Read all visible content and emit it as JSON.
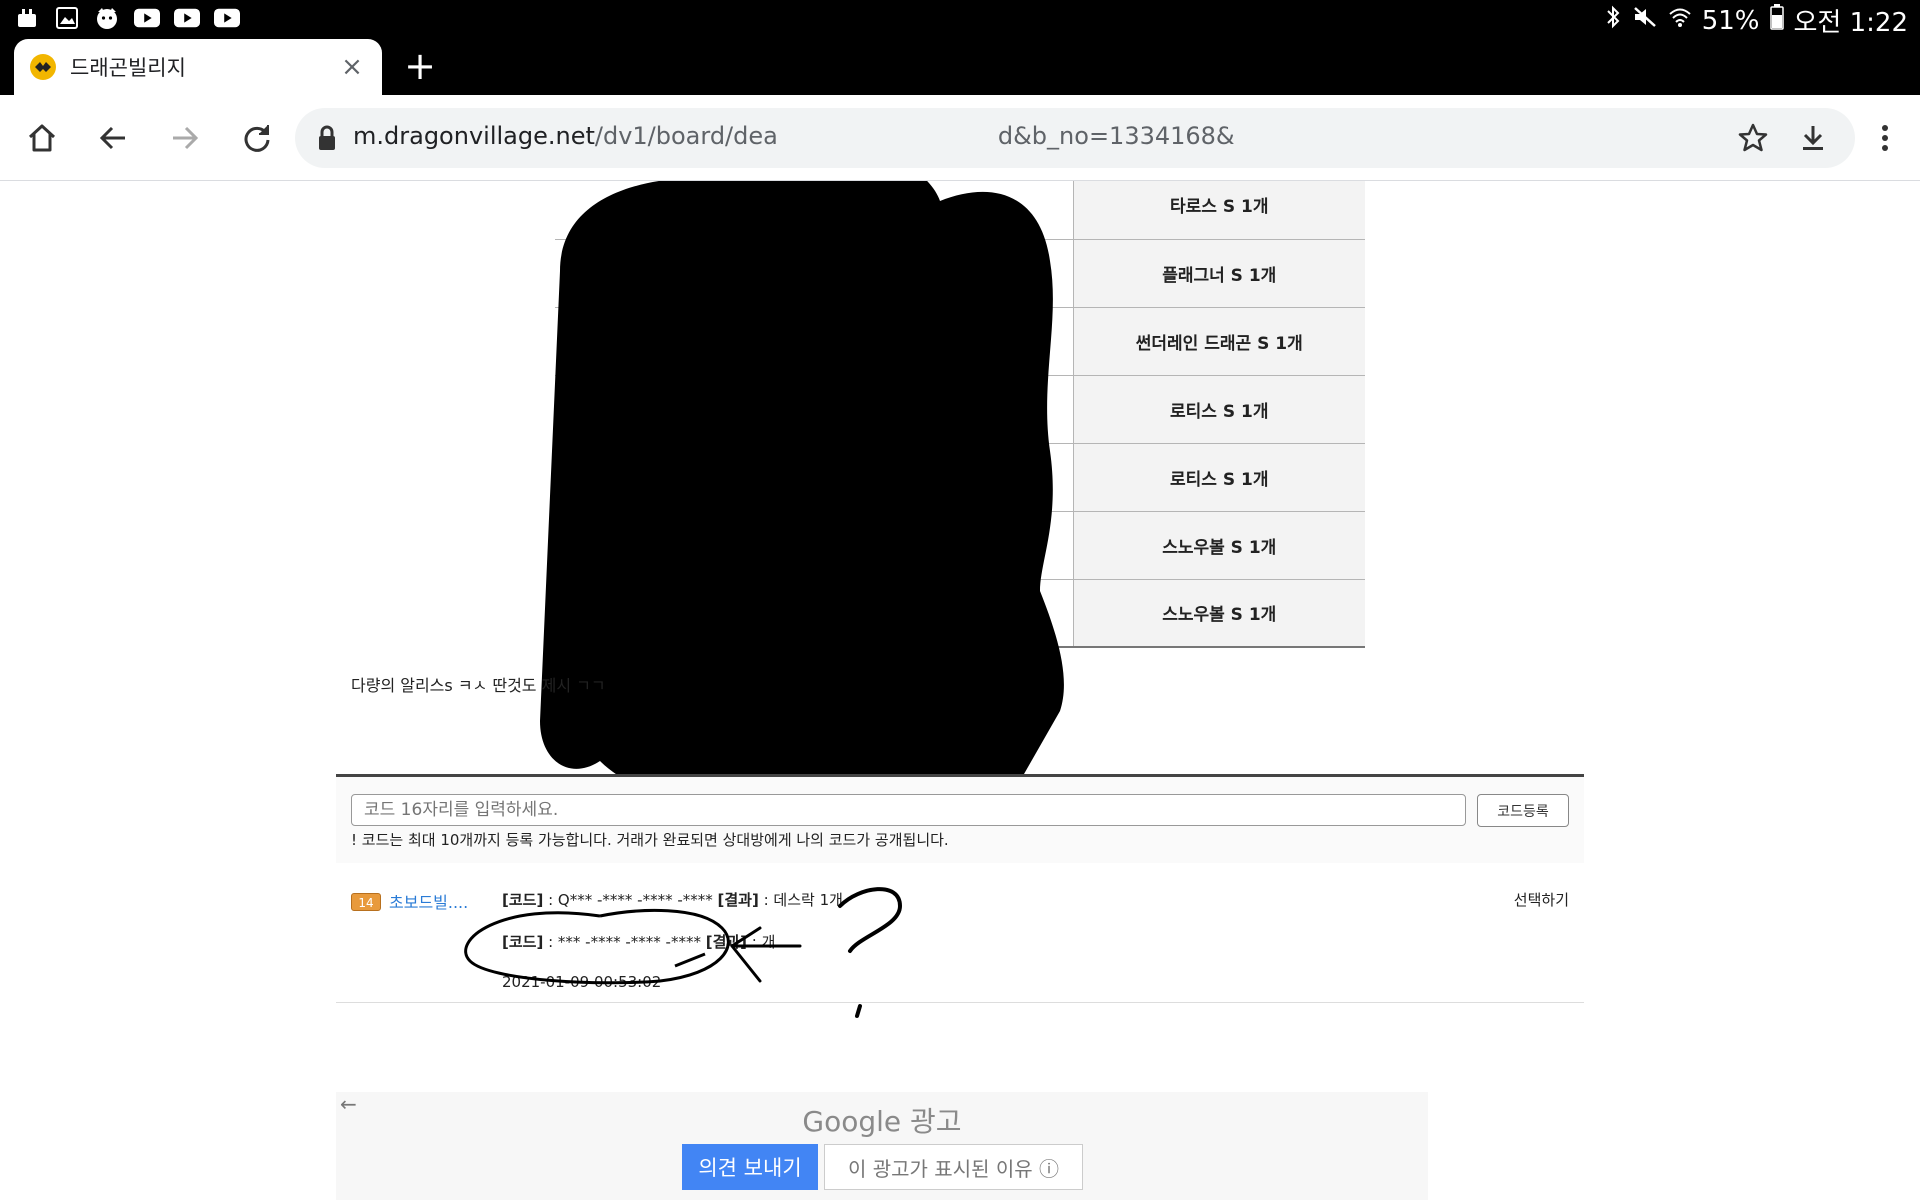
{
  "status_bar": {
    "battery": "51%",
    "time": "오전 1:22"
  },
  "browser": {
    "tab_title": "드래곤빌리지",
    "tab_close": "×",
    "new_tab": "+",
    "url_host": "m.dragonvillage.net",
    "url_path": "/dv1/board/dea",
    "url_tail": "d&b_no=1334168&"
  },
  "table": {
    "items": [
      "타로스 S 1개",
      "플래그너 S 1개",
      "썬더레인 드래곤 S 1개",
      "로티스 S 1개",
      "로티스 S 1개",
      "스노우볼 S 1개",
      "스노우볼 S 1개"
    ]
  },
  "post_body": "다량의 알리스s ㅋㅅ 딴것도 제시 ㄱㄱ",
  "code_form": {
    "placeholder": "코드 16자리를 입력하세요.",
    "submit_label": "코드등록",
    "notice": "! 코드는 최대 10개까지 등록 가능합니다. 거래가 완료되면 상대방에게 나의 코드가 공개됩니다."
  },
  "entry": {
    "level": "14",
    "user": "초보드빌....",
    "line1_code_label": "[코드]",
    "line1_code_value": " : Q*** -**** -**** -**** ",
    "line1_result_label": "[결과]",
    "line1_result_value": " : 데스락 1개",
    "line2_code_label": "[코드]",
    "line2_code_value": " : *** -**** -**** -**** ",
    "line2_result_label": "[결과]",
    "line2_result_value": " : 개",
    "date": "2021-01-09 00:53:02",
    "select_label": "선택하기"
  },
  "ad": {
    "label": "Google 광고",
    "feedback_label": "의견 보내기",
    "why_label": "이 광고가 표시된 이유 ⓘ"
  }
}
